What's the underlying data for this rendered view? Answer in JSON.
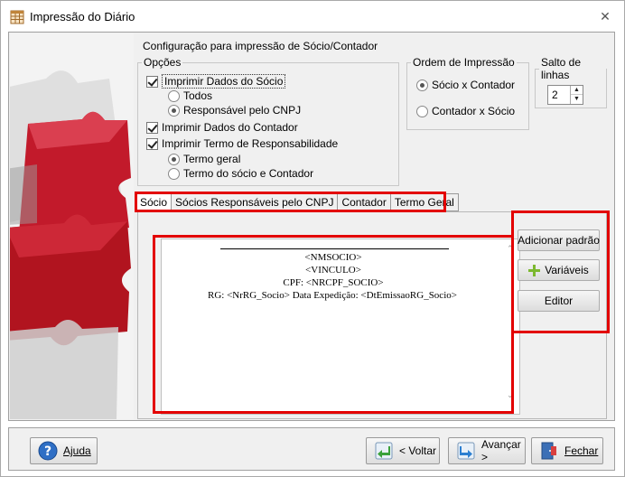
{
  "window": {
    "title": "Impressão do Diário"
  },
  "heading": "Configuração para impressão de Sócio/Contador",
  "options": {
    "legend": "Opções",
    "print_partner": "Imprimir Dados do Sócio",
    "todos": "Todos",
    "cnpj_responsible": "Responsável pelo CNPJ",
    "print_accountant": "Imprimir Dados do Contador",
    "print_term": "Imprimir Termo de Responsabilidade",
    "general_term": "Termo geral",
    "partner_accountant_term": "Termo do sócio e Contador"
  },
  "order": {
    "legend": "Ordem de Impressão",
    "option1": "Sócio x Contador",
    "option2": "Contador x Sócio"
  },
  "line_skip": {
    "legend": "Salto de linhas",
    "value": "2"
  },
  "tabs": [
    "Sócio",
    "Sócios Responsáveis pelo CNPJ",
    "Contador",
    "Termo Geral"
  ],
  "editor": {
    "lines": [
      "<NMSOCIO>",
      "<VINCULO>",
      "CPF: <NRCPF_SOCIO>"
    ],
    "rg_line": "RG: <NrRG_Socio> Data Expedição: <DtEmissaoRG_Socio>"
  },
  "side_buttons": {
    "add_default": "Adicionar padrão",
    "variables": "Variáveis",
    "editor": "Editor"
  },
  "footer": {
    "help": "Ajuda",
    "back": "< Voltar",
    "next": "Avançar >",
    "close": "Fechar"
  },
  "colors": {
    "highlight": "#e30000",
    "puzzle": "#c8102e"
  },
  "icons": {
    "window": "table-icon",
    "help": "help-icon",
    "back": "back-arrow-icon",
    "next": "next-arrow-icon",
    "close": "exit-door-icon",
    "variables": "plus-icon"
  }
}
